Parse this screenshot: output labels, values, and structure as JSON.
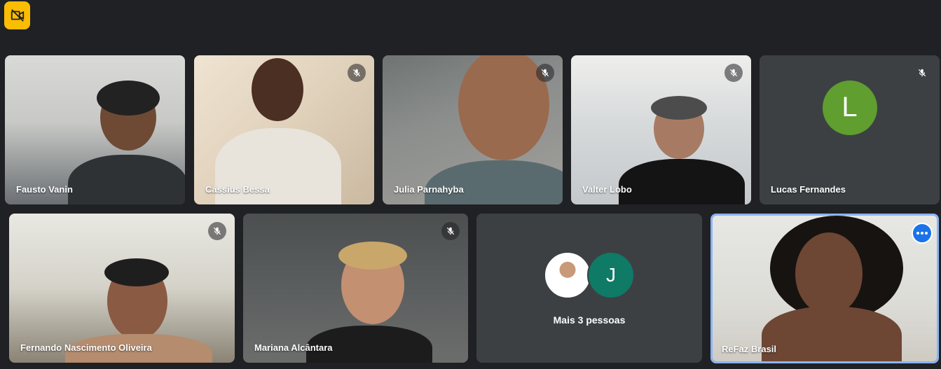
{
  "status_icon": "no-video-icon",
  "colors": {
    "background": "#202124",
    "tile": "#3c4043",
    "badge": "#fbbc04",
    "avatar_l": "#5f9e2f",
    "avatar_j": "#0f7a66",
    "pinned_border": "#8ab4f8",
    "more_button": "#1a73e8"
  },
  "participants": [
    {
      "name": "Fausto Vanin",
      "muted": false
    },
    {
      "name": "Cássius Bessa",
      "muted": true
    },
    {
      "name": "Julia Parnahyba",
      "muted": true
    },
    {
      "name": "Valter Lobo",
      "muted": true
    },
    {
      "name": "Lucas Fernandes",
      "muted": true,
      "avatar_letter": "L"
    },
    {
      "name": "Fernando Nascimento Oliveira",
      "muted": true
    },
    {
      "name": "Mariana Alcântara",
      "muted": true
    },
    {
      "name": "ReFaz Brasil",
      "muted": false,
      "pinned": true
    }
  ],
  "overflow": {
    "label": "Mais 3 pessoas",
    "avatar_letter": "J"
  }
}
